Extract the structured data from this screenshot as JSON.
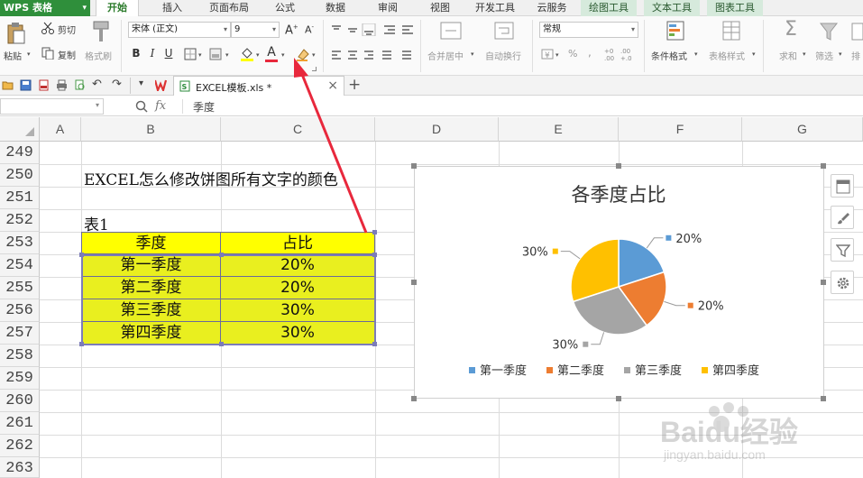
{
  "app": {
    "logo_label": "WPS 表格",
    "menu_tabs": [
      "开始",
      "插入",
      "页面布局",
      "公式",
      "数据",
      "审阅",
      "视图",
      "开发工具",
      "云服务",
      "绘图工具",
      "文本工具",
      "图表工具"
    ],
    "active_tab": "开始"
  },
  "ribbon": {
    "paste": "粘贴",
    "cut": "剪切",
    "copy": "复制",
    "format_painter": "格式刷",
    "font_name": "宋体 (正文)",
    "font_size": "9",
    "bold": "B",
    "italic": "I",
    "underline": "U",
    "font_color_glyph": "A",
    "merge_center": "合并居中",
    "wrap_text": "自动换行",
    "number_format": "常规",
    "percent": "%",
    "comma": ",",
    "conditional_format": "条件格式",
    "table_style": "表格样式",
    "sum": "求和",
    "filter": "筛选",
    "sort": "排"
  },
  "quick_access": {
    "doc_tab_label": "EXCEL模板.xls *",
    "close_glyph": "×",
    "new_tab_glyph": "+"
  },
  "formula_bar": {
    "fx_label": "fx",
    "content": "季度"
  },
  "sheet": {
    "columns": [
      "A",
      "B",
      "C",
      "D",
      "E",
      "F",
      "G"
    ],
    "rows": [
      "249",
      "250",
      "251",
      "252",
      "253",
      "254",
      "255",
      "256",
      "257",
      "258",
      "259",
      "260",
      "261",
      "262",
      "263"
    ],
    "title_text": "EXCEL怎么修改饼图所有文字的颜色",
    "table_label": "表1",
    "table_header": [
      "季度",
      "占比"
    ],
    "table_rows": [
      [
        "第一季度",
        "20%"
      ],
      [
        "第二季度",
        "20%"
      ],
      [
        "第三季度",
        "30%"
      ],
      [
        "第四季度",
        "30%"
      ]
    ]
  },
  "chart_data": {
    "type": "pie",
    "title": "各季度占比",
    "categories": [
      "第一季度",
      "第二季度",
      "第三季度",
      "第四季度"
    ],
    "values": [
      20,
      20,
      30,
      30
    ],
    "data_labels": [
      "20%",
      "20%",
      "30%",
      "30%"
    ],
    "colors": [
      "#5b9bd5",
      "#ed7d31",
      "#a5a5a5",
      "#ffc000"
    ],
    "legend_position": "bottom"
  },
  "watermark": {
    "brand": "Baidu经验",
    "url": "jingyan.baidu.com"
  },
  "colors": {
    "header_yellow": "#ffff00",
    "cell_yellow": "#e9ef1f",
    "annotation_arrow": "#e8283c",
    "wps_green": "#2f8f3b"
  }
}
